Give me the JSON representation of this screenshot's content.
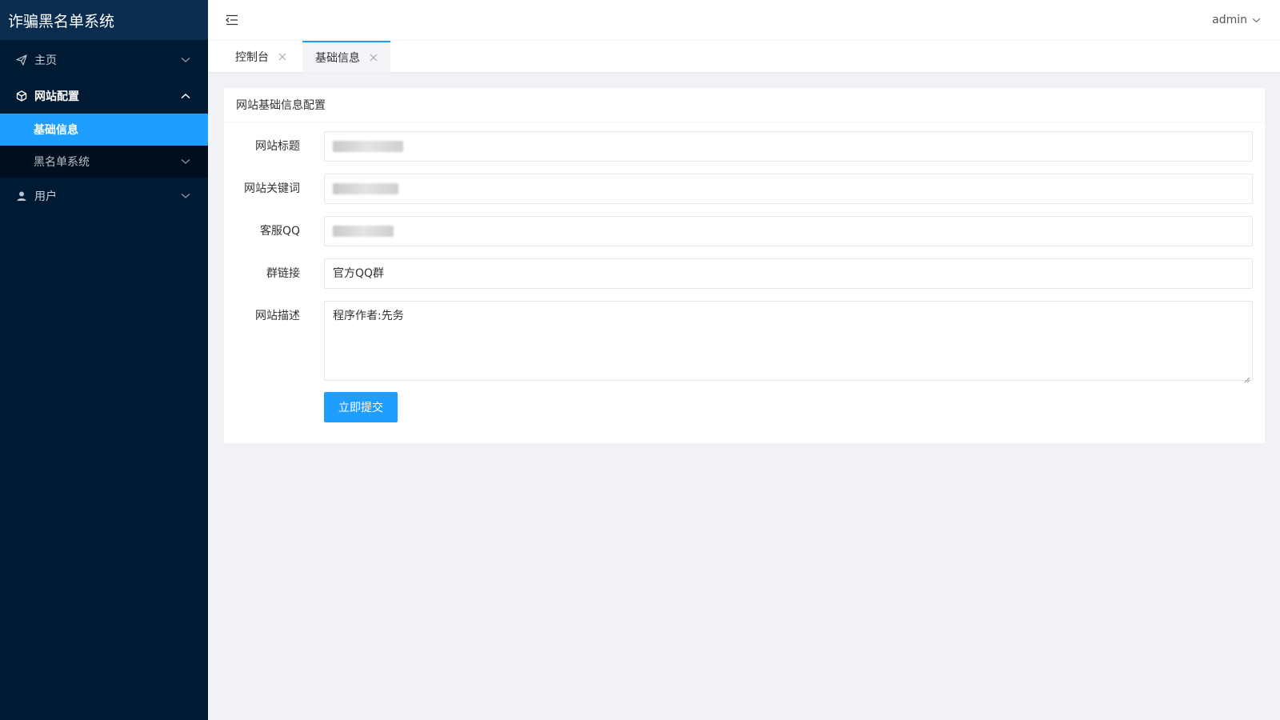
{
  "app": {
    "title": "诈骗黑名单系统"
  },
  "sidebar": {
    "items": [
      {
        "label": "主页",
        "icon": "paper-plane-icon",
        "state": "collapsed"
      },
      {
        "label": "网站配置",
        "icon": "cube-icon",
        "state": "expanded",
        "children": [
          {
            "label": "基础信息",
            "active": true
          },
          {
            "label": "黑名单系统",
            "active": false
          }
        ]
      },
      {
        "label": "用户",
        "icon": "user-icon",
        "state": "collapsed"
      }
    ]
  },
  "header": {
    "toggle_icon": "menu-fold-icon",
    "user": "admin"
  },
  "tabs": [
    {
      "label": "控制台",
      "active": false
    },
    {
      "label": "基础信息",
      "active": true
    }
  ],
  "form": {
    "title": "网站基础信息配置",
    "fields": [
      {
        "label": "网站标题",
        "value": ""
      },
      {
        "label": "网站关键词",
        "value": ""
      },
      {
        "label": "客服QQ",
        "value": ""
      },
      {
        "label": "群链接",
        "value": "官方QQ群"
      },
      {
        "label": "网站描述",
        "value": "程序作者:先务"
      }
    ],
    "submit_label": "立即提交"
  },
  "colors": {
    "sidebar_bg": "#011a33",
    "logo_bg": "#0a2c4f",
    "accent": "#1e9fff",
    "page_bg": "#f0f2f5"
  }
}
